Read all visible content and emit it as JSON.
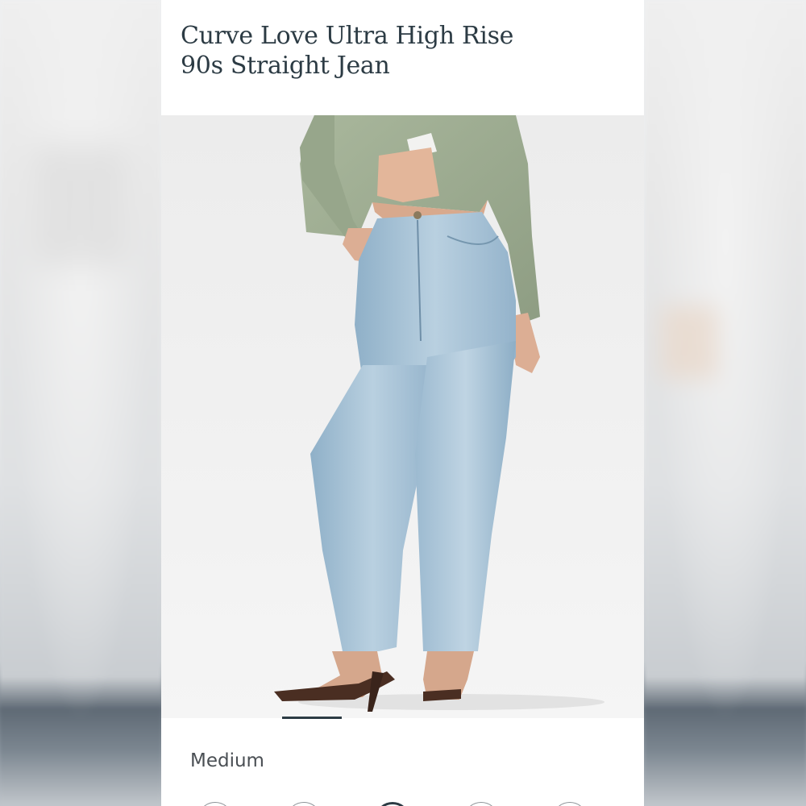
{
  "product": {
    "title_line1": "Curve Love Ultra High Rise",
    "title_line2": "90s Straight Jean"
  },
  "gallery": {
    "image_subject": "model wearing light wash straight jeans with green cardigan and strappy heels"
  },
  "size": {
    "selected_label": "Medium"
  },
  "colors": {
    "title": "#2c3b44",
    "denim": "#a9c3d6",
    "cardigan": "#9fae92",
    "background": "#efefef"
  },
  "swatches": [
    {
      "id": "swatch-1",
      "selected": false
    },
    {
      "id": "swatch-2",
      "selected": false
    },
    {
      "id": "swatch-3",
      "selected": true
    },
    {
      "id": "swatch-4",
      "selected": false
    },
    {
      "id": "swatch-5",
      "selected": false
    }
  ]
}
